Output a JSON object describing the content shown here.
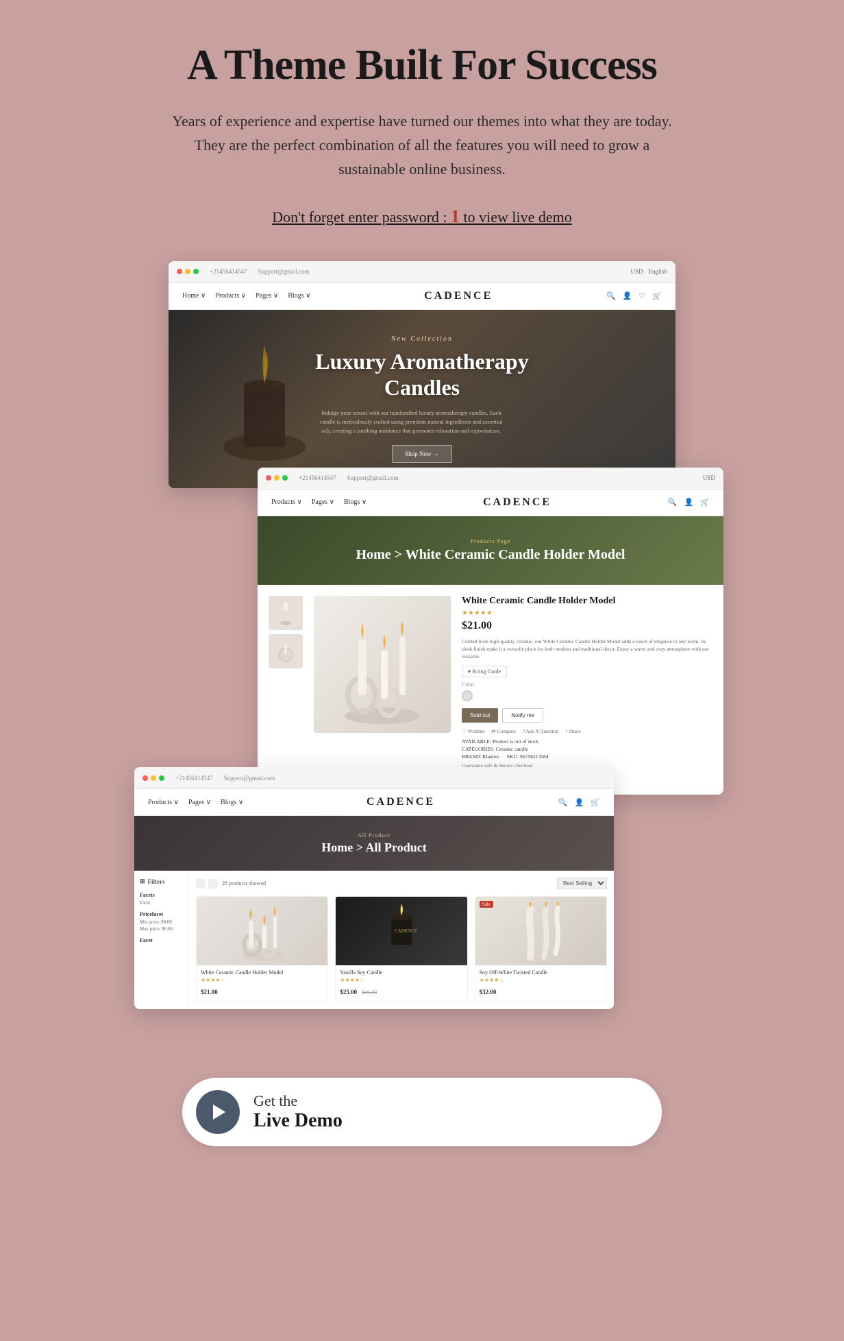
{
  "page": {
    "bg_color": "#c9a0a0"
  },
  "header": {
    "title": "A Theme Built For Success",
    "subtitle": "Years of experience and expertise have turned our themes into what they are today. They are the perfect combination of all the features you will need to grow a sustainable online business.",
    "password_note": "Don't forget enter password :",
    "password_value": "1",
    "password_suffix": " to view live demo"
  },
  "screenshot1": {
    "brand": "CADENCE",
    "contact": "+21456414547",
    "email": "Support@gmail.com",
    "currency": "USD",
    "language": "English",
    "nav_items": [
      "Home",
      "Products",
      "Pages",
      "Blogs"
    ],
    "hero_eyebrow": "New Collection",
    "hero_title": "Luxury Aromatherapy\nCandles",
    "hero_desc": "Indulge your senses with our handcrafted luxury aromatherapy candles. Each candle is meticulously crafted using premium natural ingredients and essential oils, creating a soothing ambiance that promotes relaxation and rejuvenation.",
    "hero_btn": "Shop Now →"
  },
  "screenshot2": {
    "brand": "CADENCE",
    "products_page_label": "Products Page",
    "breadcrumb": "Home > White Ceramic Candle Holder Model",
    "product_name": "White Ceramic Candle Holder Model",
    "stars": "★★★★★",
    "price": "$21.00",
    "description": "Crafted from high-quality ceramic, our White Ceramic Candle Holder Model adds a touch of elegance to any room. Its sleek finish make it a versatile piece for both modern and traditional decor. Enjoy a warm and cozy atmosphere with our versatile",
    "sizing_guide": "▾ Sizing Guide",
    "color_label": "Color",
    "btn_sold": "Sold out",
    "btn_notify": "Notify me",
    "wishlist": "♡ Wishlist",
    "compare": "⇄ Compare",
    "ask_question": "? Ask A Question",
    "share": "↑ Share",
    "available_label": "AVAILABLE:",
    "available_value": "Product is out of stock",
    "categories_label": "CATEGORIES:",
    "categories_value": "Ceramic candle",
    "brand_label": "BRAND:",
    "brand_value": "Klanten",
    "sku_label": "SKU:",
    "sku_value": "S6756213584",
    "guarantee": "Guarantee safe & Secure checkout"
  },
  "screenshot3": {
    "brand": "CADENCE",
    "all_product_label": "All Product",
    "breadcrumb": "Home > All Product",
    "filter_header": "Filters",
    "product_count": "28 products showed",
    "sort_label": "Sort by: Best Selling",
    "filter_sections": [
      {
        "title": "Facets",
        "items": [
          "Facet"
        ]
      },
      {
        "title": "Pricefacet",
        "items": [
          "Min price: $0.00",
          "Max price: $0.00"
        ]
      },
      {
        "title": "Facet",
        "items": []
      }
    ],
    "products": [
      {
        "name": "White Ceramic Candle Holder Model",
        "price": "$21.00",
        "stars": "★★★★☆",
        "sale": false
      },
      {
        "name": "Vanilla Soy Candle",
        "price": "$25.00",
        "old_price": "$46.00",
        "stars": "★★★★☆",
        "sale": false
      },
      {
        "name": "Soy Off-White Twisted Candle",
        "price": "$32.00",
        "stars": "★★★★☆",
        "sale": true
      }
    ]
  },
  "cta": {
    "get_text": "Get the",
    "live_demo_text": "Live Demo"
  }
}
